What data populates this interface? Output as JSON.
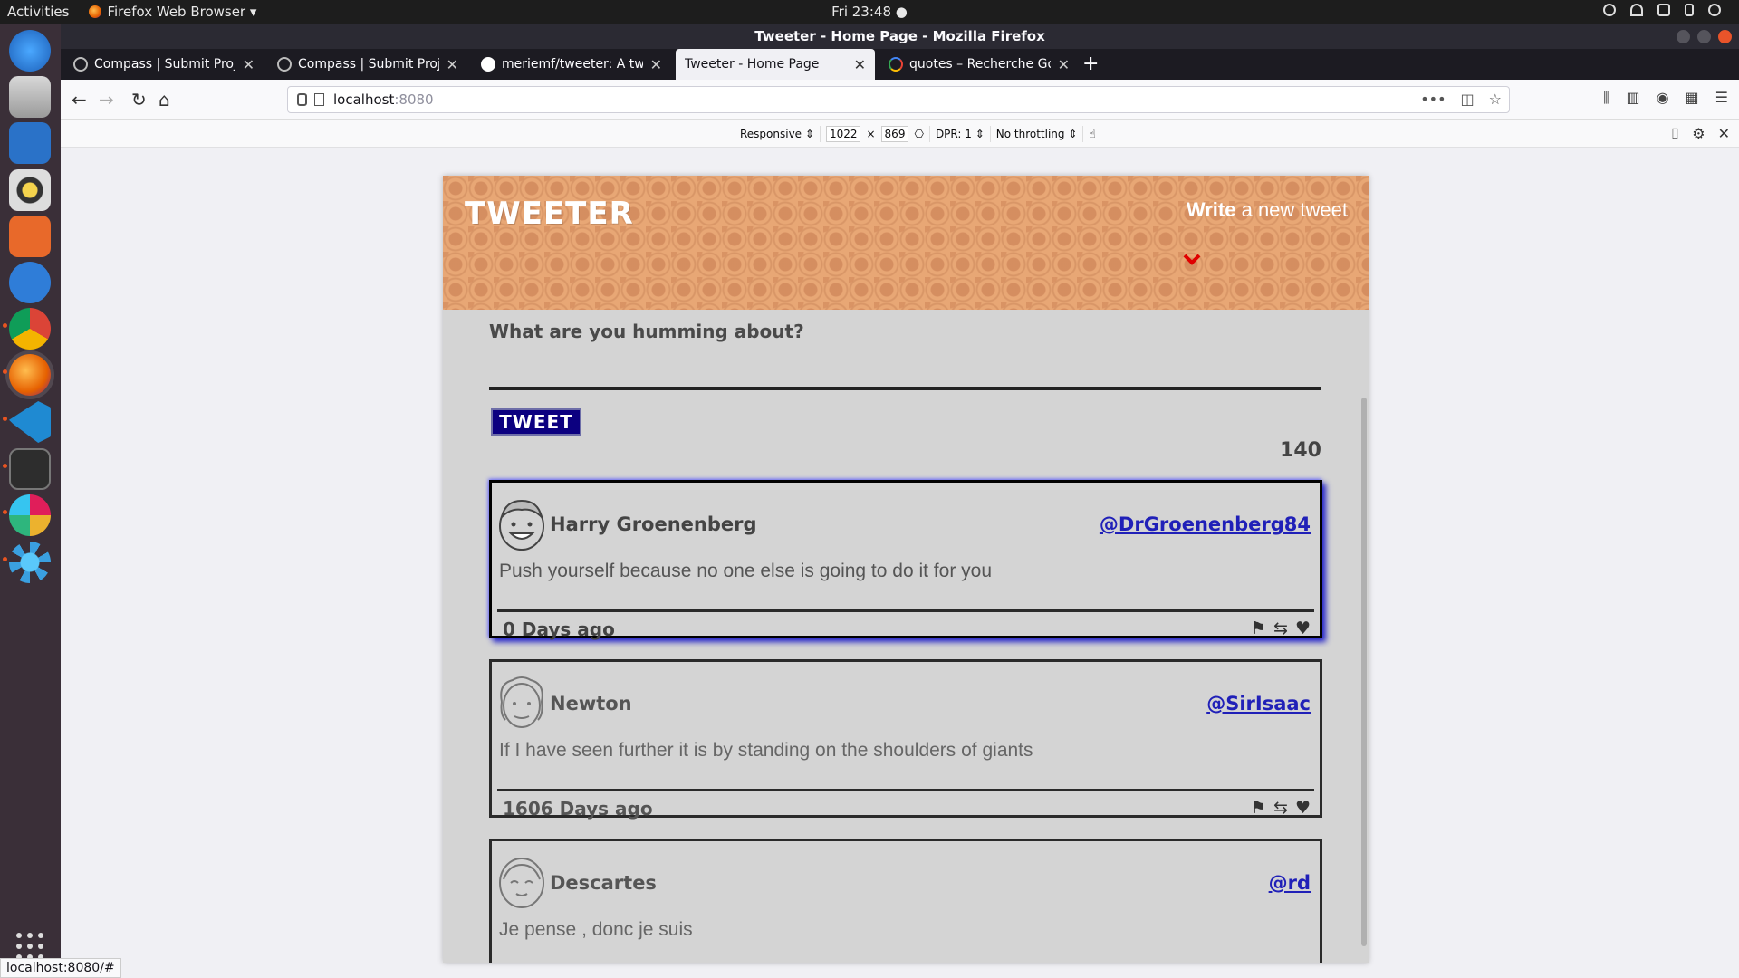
{
  "topbar": {
    "activities": "Activities",
    "app_menu": "Firefox Web Browser ▾",
    "clock": "Fri 23:48 ●"
  },
  "window": {
    "title": "Tweeter - Home Page - Mozilla Firefox"
  },
  "tabs": [
    {
      "label": "Compass | Submit Projec",
      "icon": "compass-icon"
    },
    {
      "label": "Compass | Submit Projec",
      "icon": "compass-icon"
    },
    {
      "label": "meriemf/tweeter: A twit",
      "icon": "github-icon"
    },
    {
      "label": "Tweeter - Home Page",
      "icon": "none",
      "selected": true
    },
    {
      "label": "quotes – Recherche Goo",
      "icon": "google-icon"
    }
  ],
  "url": {
    "host": "localhost",
    "port": ":8080"
  },
  "rdm": {
    "device": "Responsive ⇕",
    "width": "1022",
    "times": "×",
    "height": "869",
    "dpr": "DPR: 1 ⇕",
    "throttling": "No throttling ⇕"
  },
  "site": {
    "logo": "TWEETER",
    "compose_bold": "Write",
    "compose_rest": " a new tweet",
    "compose_label": "What are you humming about?",
    "tweet_button": "TWEET",
    "counter": "140"
  },
  "tweets": [
    {
      "name": "Harry Groenenberg",
      "handle": "@DrGroenenberg84",
      "content": "Push yourself because no one else is going to do it for you",
      "age": "0 Days ago"
    },
    {
      "name": "Newton",
      "handle": "@SirIsaac",
      "content": "If I have seen further it is by standing on the shoulders of giants",
      "age": "1606 Days ago"
    },
    {
      "name": "Descartes",
      "handle": "@rd",
      "content": "Je pense , donc je suis",
      "age": ""
    }
  ],
  "status_bar": "localhost:8080/#",
  "colors": {
    "header_bg": "#e8a775",
    "tweet_button_bg": "#0c0080",
    "handle": "#2020b8",
    "arrow": "#e00000"
  }
}
